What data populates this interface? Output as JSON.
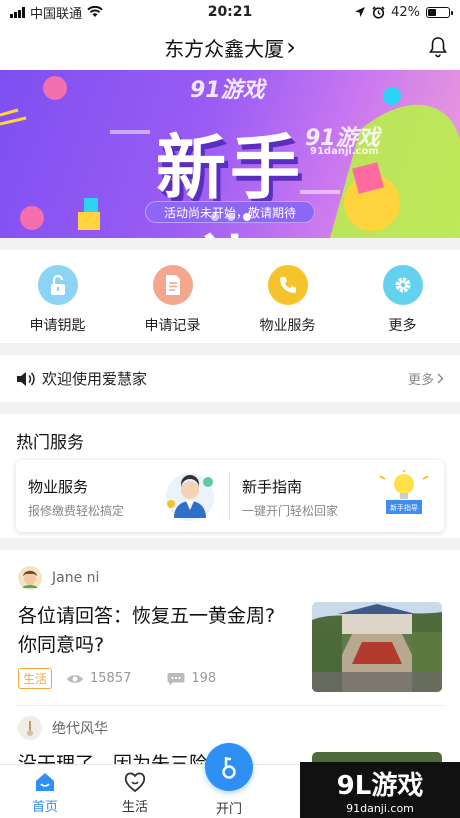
{
  "status": {
    "carrier": "中国联通",
    "time": "20:21",
    "battery": "42%",
    "battery_level": 0.42
  },
  "header": {
    "title": "东方众鑫大厦",
    "chevron": "›"
  },
  "banner": {
    "headline": "新手礼",
    "pill": "活动尚未开始，敬请期待",
    "watermark": "91游戏",
    "watermark_url": "91danji.com",
    "pages": 3,
    "active_page": 2
  },
  "quick_actions": [
    {
      "label": "申请钥匙",
      "icon": "unlock-icon",
      "color": "#8dd3f5"
    },
    {
      "label": "申请记录",
      "icon": "document-icon",
      "color": "#f4a68f"
    },
    {
      "label": "物业服务",
      "icon": "phone-icon",
      "color": "#f5c32c"
    },
    {
      "label": "更多",
      "icon": "gear-icon",
      "color": "#64d2ee"
    }
  ],
  "notice": {
    "text": "欢迎使用爱慧家",
    "more": "更多"
  },
  "hot": {
    "heading": "热门服务",
    "cards": [
      {
        "title": "物业服务",
        "sub": "报修缴费轻松搞定"
      },
      {
        "title": "新手指南",
        "sub": "一键开门轻松回家",
        "badge": "新手指导"
      }
    ]
  },
  "feed": [
    {
      "user": "Jane ni",
      "title": "各位请回答：恢复五一黄金周?你同意吗?",
      "tag": "生活",
      "views": "15857",
      "comments": "198"
    },
    {
      "user": "绝代风华",
      "title": "没干理了，因为朱三险…"
    }
  ],
  "tabs": {
    "home": "首页",
    "life": "生活",
    "open": "开门",
    "accent": "#2e8ff5"
  },
  "watermark_bottom": {
    "brand": "9L游戏",
    "url": "91danji.com"
  }
}
